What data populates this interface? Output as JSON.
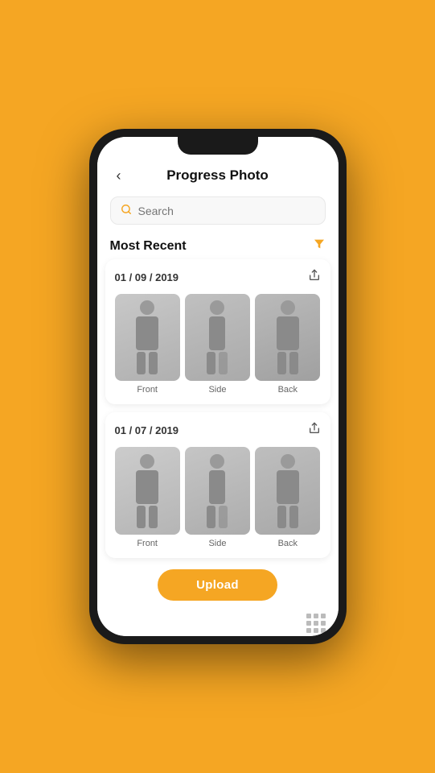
{
  "header": {
    "back_label": "‹",
    "title": "Progress Photo"
  },
  "search": {
    "placeholder": "Search"
  },
  "section": {
    "title": "Most Recent"
  },
  "cards": [
    {
      "date": "01 / 09 / 2019",
      "photos": [
        {
          "label": "Front"
        },
        {
          "label": "Side"
        },
        {
          "label": "Back"
        }
      ]
    },
    {
      "date": "01 / 07 / 2019",
      "photos": [
        {
          "label": "Front"
        },
        {
          "label": "Side"
        },
        {
          "label": "Back"
        }
      ]
    }
  ],
  "upload_button": "Upload"
}
